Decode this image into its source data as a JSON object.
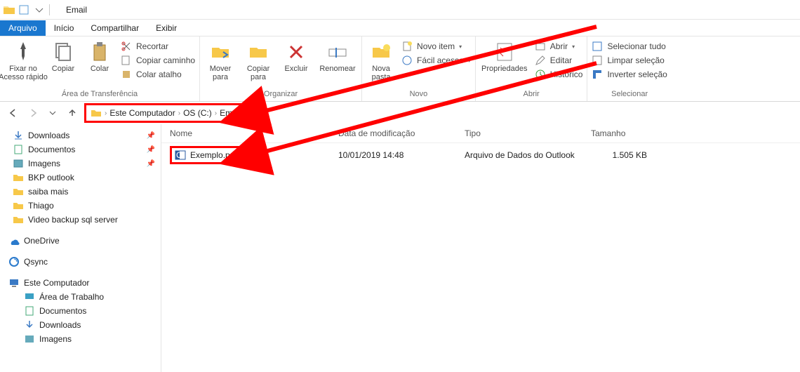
{
  "window_title": "Email",
  "tabs": {
    "file": "Arquivo",
    "home": "Início",
    "share": "Compartilhar",
    "view": "Exibir"
  },
  "ribbon": {
    "clipboard": {
      "pin": "Fixar no\nAcesso rápido",
      "copy": "Copiar",
      "paste": "Colar",
      "cut": "Recortar",
      "copy_path": "Copiar caminho",
      "paste_shortcut": "Colar atalho",
      "label": "Área de Transferência"
    },
    "organize": {
      "move": "Mover\npara",
      "copy_to": "Copiar\npara",
      "delete": "Excluir",
      "rename": "Renomear",
      "label": "Organizar"
    },
    "new": {
      "new_folder": "Nova\npasta",
      "new_item": "Novo item",
      "easy_access": "Fácil acesso",
      "label": "Novo"
    },
    "open": {
      "properties": "Propriedades",
      "open": "Abrir",
      "edit": "Editar",
      "history": "Histórico",
      "label": "Abrir"
    },
    "select": {
      "select_all": "Selecionar tudo",
      "select_none": "Limpar seleção",
      "invert": "Inverter seleção",
      "label": "Selecionar"
    }
  },
  "breadcrumbs": [
    "Este Computador",
    "OS (C:)",
    "Email"
  ],
  "columns": {
    "name": "Nome",
    "date": "Data de modificação",
    "type": "Tipo",
    "size": "Tamanho"
  },
  "file": {
    "name": "Exemplo.pst",
    "date": "10/01/2019 14:48",
    "type": "Arquivo de Dados do Outlook",
    "size": "1.505 KB"
  },
  "tree": {
    "downloads": "Downloads",
    "documents": "Documentos",
    "images": "Imagens",
    "bkp": "BKP outlook",
    "saiba": "saiba mais",
    "thiago": "Thiago",
    "video": "Video backup sql server",
    "onedrive": "OneDrive",
    "qsync": "Qsync",
    "thispc": "Este Computador",
    "desktop": "Área de Trabalho",
    "docs2": "Documentos",
    "downloads2": "Downloads",
    "images2": "Imagens"
  }
}
